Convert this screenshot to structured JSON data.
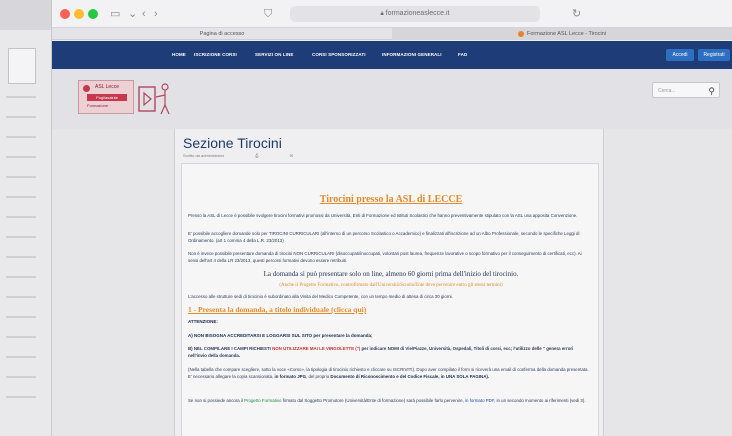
{
  "browser": {
    "address": "formazioneaslecce.it",
    "tab_left": "Pagina di accesso",
    "tab_right": "Formazione ASL Lecce - Tirocini"
  },
  "nav": {
    "items": [
      "HOME",
      "ISCRIZIONE CORSI",
      "SERVIZI ON LINE",
      "CORSI SPONSORIZZATI",
      "INFORMAZIONI GENERALI",
      "FAD"
    ],
    "login": "Accedi",
    "register": "Registrati"
  },
  "header": {
    "logo_line1": "ASL Lecce",
    "logo_line2": "Pugliasalute",
    "logo_line3": "Formazione",
    "search_placeholder": "Cerca..."
  },
  "page": {
    "title": "Sezione Tirocini",
    "meta_author": "Scritto da administrator",
    "meta_extra": ""
  },
  "content": {
    "heading": "Tirocini presso la ASL di LECCE",
    "p1": "Presso la ASL di Lecce è possibile svolgere tirocini formativi promossi da Università, Enti di Formazione ed Istituti Scolastici che hanno preventivamente stipulato con la ASL una apposita Convenzione.",
    "p2": "E' possibile accogliere domande solo per TIROCINI CURRICULARI (all'interno di un percorso Scolastico o Accademico) e finalizzati all'iscrizione ad un Albo Professionale, secondo le specifiche Leggi di Ordinamento. (art 1 comma 4 della L.R. 23/2013)",
    "p3": "Non è invece possibile presentare domanda di tirocini NON CURRICULARI (disoccupati/inoccupati, volontari post laurea, frequenze lavorative o scopo formativo per il conseguimento di certificati, ecc). Ai sensi dell'art 4 della LR 23/2013, questi percorsi formativi devono essere retribuiti.",
    "line_big": "La domanda si può presentare solo on line, almeno 60 giorni prima dell'inizio del tirocinio.",
    "line_orange": "(Anche il Progetto Formativo, controfirmato dall'Università/Scuola/Ente deve pervenire entro gli stessi termini)",
    "p4": "L'accesso alle strutture sedi di tirocinio è subordinato alla Visita del Medico Competente, con un tempo medio di attesa di circa 30 giorni.",
    "section1": "1 - Presenta la domanda, a titolo individuale (clicca qui)",
    "attention": "ATTENZIONE:",
    "point_a": "A) NON BISOGNA ACCREDITARSI E LOGGARSI SUL SITO per presentare la domanda;",
    "point_b_pre": "B) NEL COMPILARE I CAMPI RICHIESTI ",
    "point_b_red": "NON UTILIZZARE MAI LE VIRGOLETTE (\") ",
    "point_b_post": "per indicare NOMI di Vie/Piazze, Università, Ospedali, Titoli di corsi, ecc; l'utilizzo delle \" genera errori nell'invio della domanda.",
    "p5_pre": "(Nella tabella che compare scegliere, sotto la voce «Corso», la tipologia di tirocinio richiesto e cliccare su ISCRIVITI). Dopo aver compilato il form si riceverà una email di conferma della domanda presentata. E' necessario allegare la copia scansionata, ",
    "p5_blue": "in formato JPG",
    "p5_mid": ", del proprio ",
    "p5_b2": "Documento di Riconoscimento e del Codice Fiscale",
    "p5_end": ", in UNA SOLA PAGINA).",
    "p6_pre": "Se non si possiede ancora il ",
    "p6_green": "Progetto Formativo",
    "p6_mid": " firmato dal Soggetto Promotore (Università/Ente di formazione) sarà possibile farlo pervenire, ",
    "p6_blue": "in formato PDF",
    "p6_end": ", in un secondo momento ai riferimenti (vedi 3)."
  },
  "colors": {
    "nav_bg": "#1d3c78",
    "accent_orange": "#e38b2a",
    "title_blue": "#1f3a66"
  }
}
